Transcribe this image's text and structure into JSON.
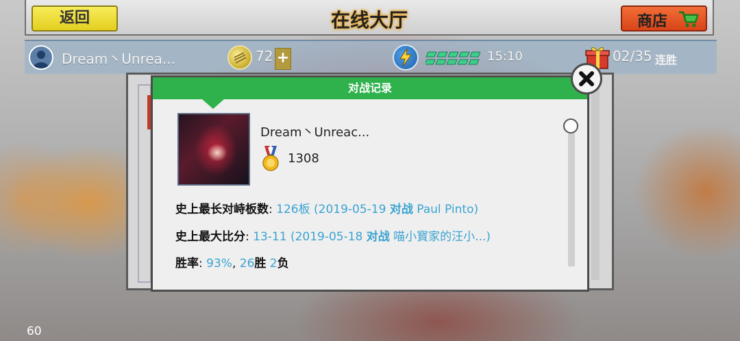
{
  "topbar": {
    "back_label": "返回",
    "title": "在线大厅",
    "shop_label": "商店"
  },
  "status": {
    "username": "Dream丶Unrea...",
    "coins": "72",
    "plus": "+",
    "energy_timer": "15:10",
    "streak_count": "02/35",
    "streak_label": "连胜"
  },
  "dialog": {
    "title": "对战记录",
    "player_name": "Dream丶Unreac...",
    "rating": "1308",
    "stats": {
      "longest_rally_label": "史上最长对峙板数",
      "longest_rally_value": "126板 (2019-05-19 ",
      "longest_rally_vs": "对战",
      "longest_rally_opponent": "  Paul Pinto)",
      "max_score_label": "史上最大比分",
      "max_score_value": "13-11 (2019-05-18 ",
      "max_score_vs": "对战",
      "max_score_opponent": "  喵小寳家的汪小...)",
      "winrate_label": "胜率",
      "winrate_value": "93%",
      "wins_count": "26",
      "wins_label": "胜",
      "losses_count": "2",
      "losses_label": "负"
    }
  },
  "fps": "60",
  "colors": {
    "header_green": "#2fb24c",
    "value_blue": "#3aa3d1",
    "back_yellow": "#e9d52a",
    "shop_orange": "#e0511f"
  }
}
